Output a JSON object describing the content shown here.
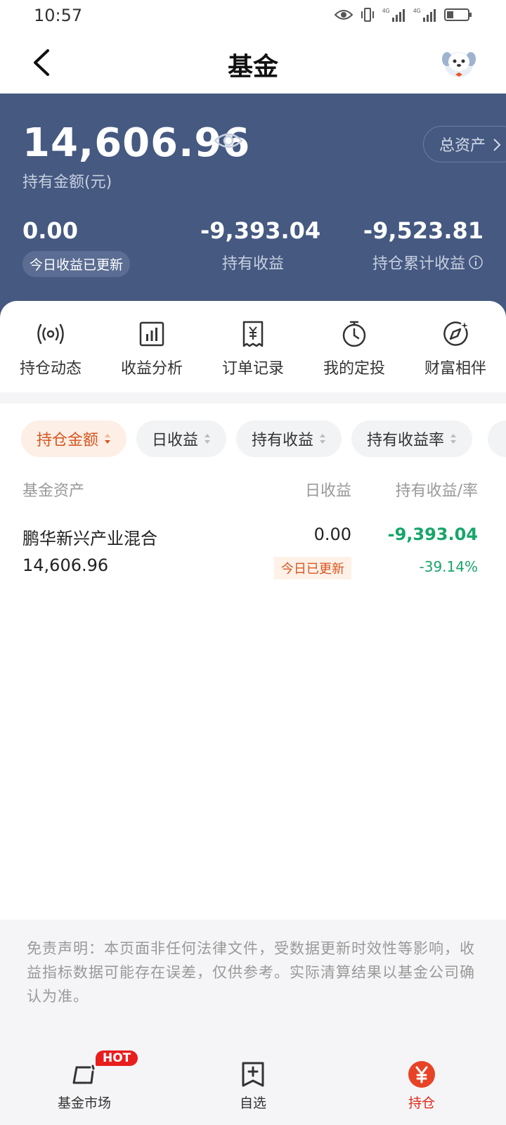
{
  "status": {
    "time": "10:57"
  },
  "header": {
    "title": "基金"
  },
  "summary": {
    "total_amount": "14,606.96",
    "amount_label": "持有金额(元)",
    "total_assets_label": "总资产",
    "stats": [
      {
        "value": "0.00",
        "label": "今日收益已更新"
      },
      {
        "value": "-9,393.04",
        "label": "持有收益"
      },
      {
        "value": "-9,523.81",
        "label": "持仓累计收益"
      }
    ]
  },
  "actions": [
    {
      "label": "持仓动态",
      "icon": "broadcast-icon"
    },
    {
      "label": "收益分析",
      "icon": "bar-chart-icon"
    },
    {
      "label": "订单记录",
      "icon": "receipt-icon"
    },
    {
      "label": "我的定投",
      "icon": "timer-icon"
    },
    {
      "label": "财富相伴",
      "icon": "compass-icon"
    }
  ],
  "sort_chips": [
    {
      "label": "持仓金额",
      "active": true
    },
    {
      "label": "日收益",
      "active": false
    },
    {
      "label": "持有收益",
      "active": false
    },
    {
      "label": "持有收益率",
      "active": false
    }
  ],
  "table": {
    "headers": {
      "fund": "基金资产",
      "daily": "日收益",
      "hold": "持有收益/率"
    },
    "rows": [
      {
        "name": "鹏华新兴产业混合",
        "amount": "14,606.96",
        "daily": "0.00",
        "updated": "今日已更新",
        "hold_profit": "-9,393.04",
        "hold_rate": "-39.14%"
      }
    ]
  },
  "disclaimer": "免责声明：本页面非任何法律文件，受数据更新时效性等影响，收益指标数据可能存在误差，仅供参考。实际清算结果以基金公司确认为准。",
  "bottom_nav": [
    {
      "label": "基金市场",
      "badge": "HOT",
      "active": false
    },
    {
      "label": "自选",
      "active": false
    },
    {
      "label": "持仓",
      "active": true
    }
  ],
  "colors": {
    "summary_bg": "#455981",
    "accent": "#d8551f",
    "loss_green": "#16a66a",
    "nav_active": "#e02818"
  }
}
